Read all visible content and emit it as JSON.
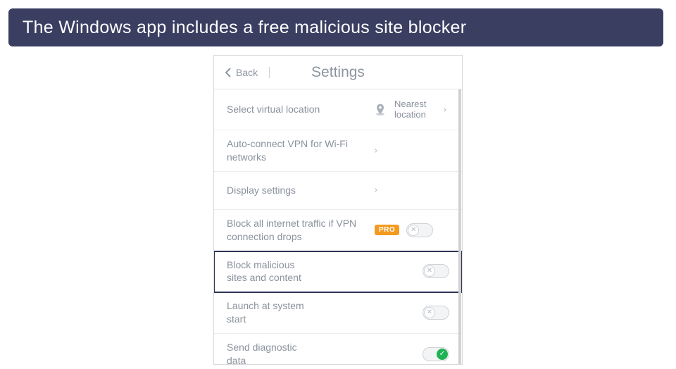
{
  "banner": {
    "text": "The Windows app includes a free malicious site blocker"
  },
  "header": {
    "back_label": "Back",
    "title": "Settings"
  },
  "rows": {
    "location": {
      "label": "Select virtual location",
      "value_line1": "Nearest",
      "value_line2": "location"
    },
    "autoconnect": {
      "label": "Auto-connect VPN for Wi-Fi networks"
    },
    "display": {
      "label": "Display settings"
    },
    "blocktraffic": {
      "label": "Block all internet traffic if VPN connection drops",
      "badge": "PRO",
      "enabled": false
    },
    "malicious": {
      "label": "Block malicious sites and content",
      "enabled": false
    },
    "launch": {
      "label": "Launch at system start",
      "enabled": false
    },
    "diagnostic": {
      "label": "Send diagnostic data",
      "enabled": true
    }
  }
}
